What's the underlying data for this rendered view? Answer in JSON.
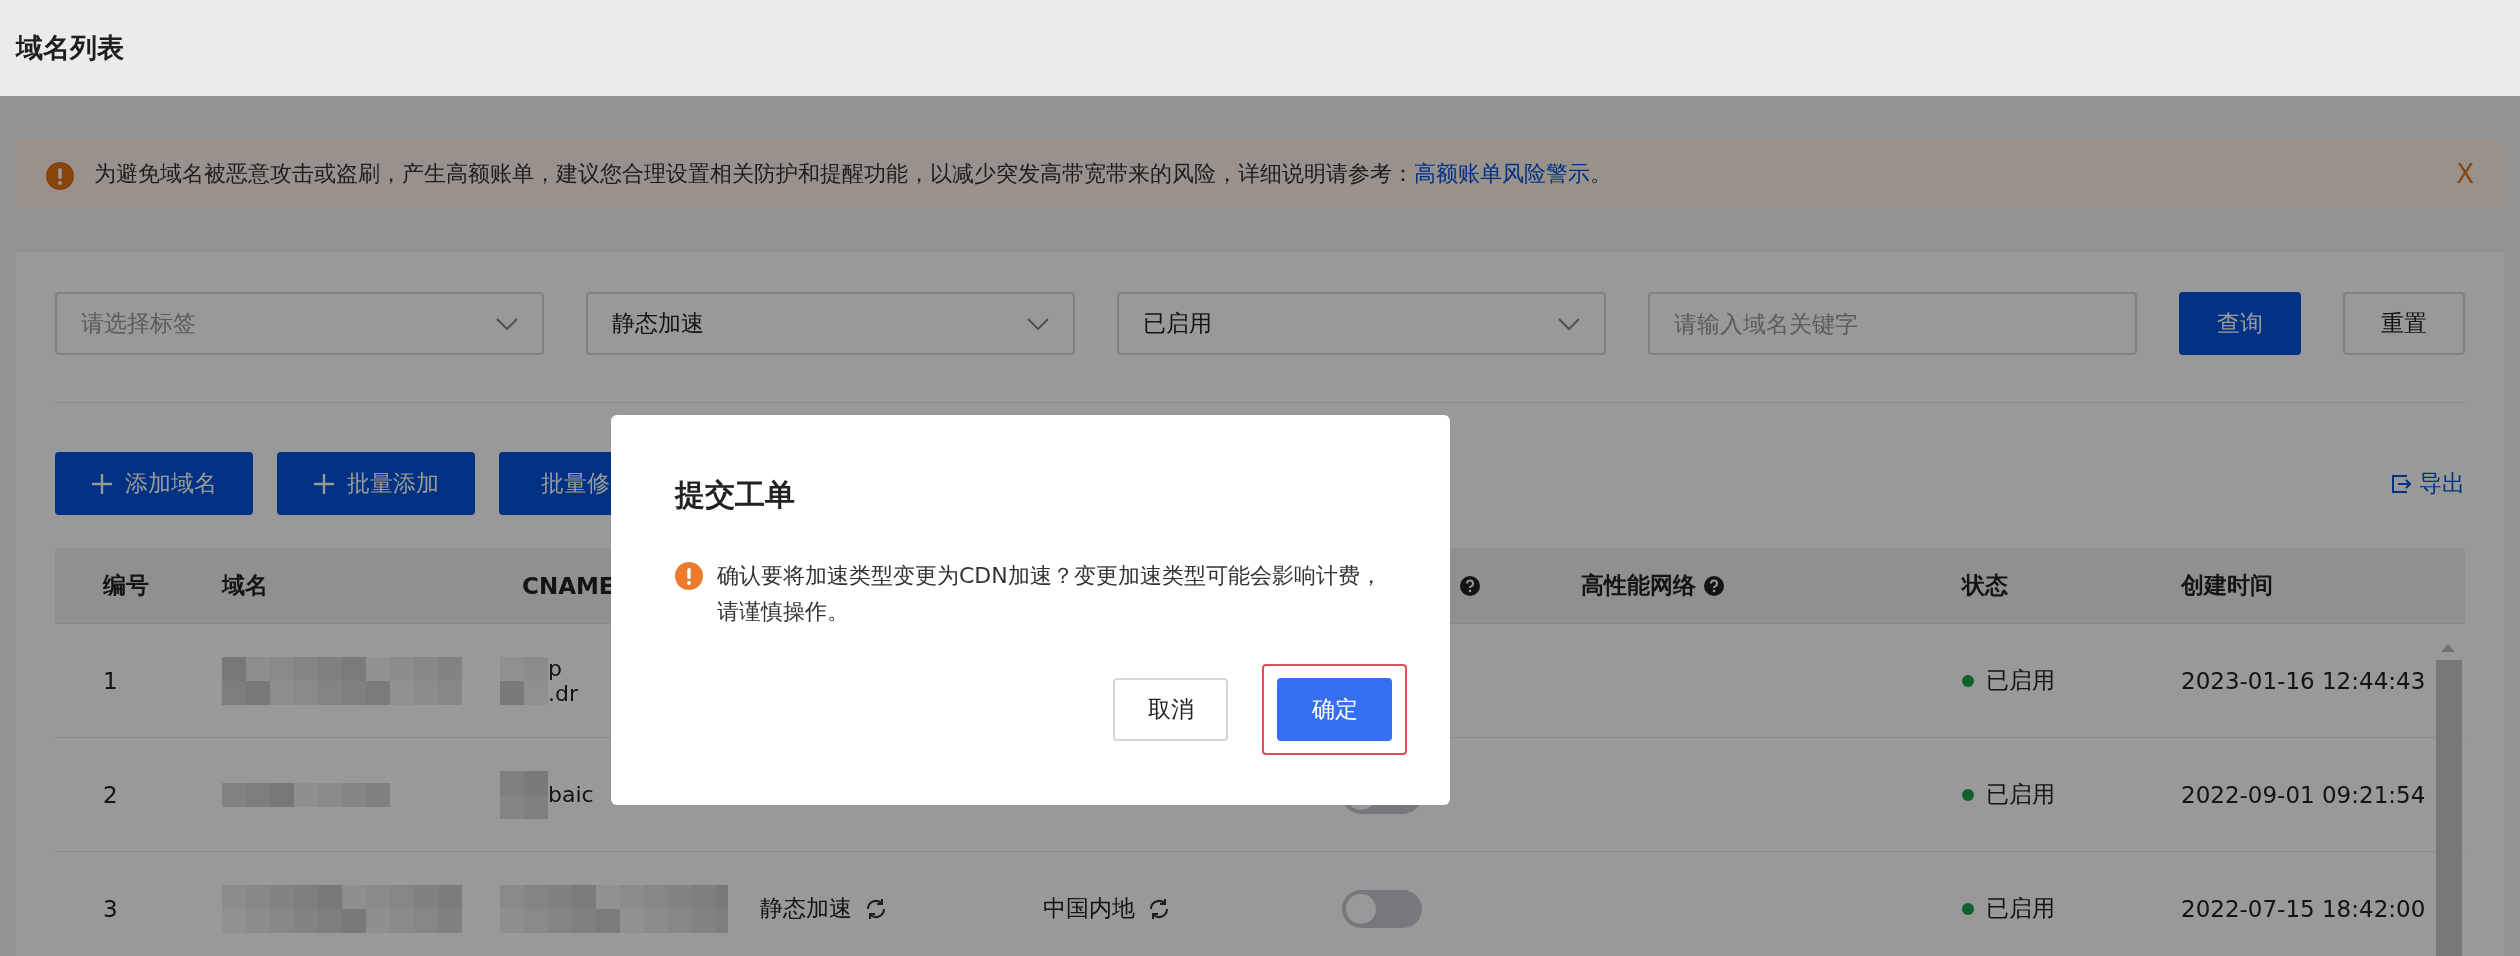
{
  "page_title": "域名列表",
  "alert": {
    "message": "为避免域名被恶意攻击或盗刷，产生高额账单，建议您合理设置相关防护和提醒功能，以减少突发高带宽带来的风险，详细说明请参考：",
    "link": "高额账单风险警示",
    "suffix": "。",
    "close": "X"
  },
  "filters": [
    {
      "kind": "select",
      "placeholder": "请选择标签"
    },
    {
      "kind": "select",
      "value": "静态加速"
    },
    {
      "kind": "select",
      "value": "已启用"
    },
    {
      "kind": "input",
      "placeholder": "请输入域名关键字"
    }
  ],
  "search_button": "查询",
  "reset_button": "重置",
  "actions": [
    {
      "label": "添加域名",
      "plus": true
    },
    {
      "label": "批量添加",
      "plus": true
    },
    {
      "label": "批量修",
      "plus": false
    }
  ],
  "export": "导出",
  "table": {
    "columns": [
      {
        "label": "编号"
      },
      {
        "label": "域名"
      },
      {
        "label": "CNAME"
      },
      {},
      {},
      {
        "help": true
      },
      {
        "label": "高性能网络",
        "help": true
      },
      {
        "label": "状态"
      },
      {
        "label": "创建时间"
      }
    ],
    "rows": [
      {
        "number": "1",
        "cname_fragments": [
          "p",
          ".dr"
        ],
        "status": "已启用",
        "created": "2023-01-16 12:44:43"
      },
      {
        "number": "2",
        "cname_fragments": [
          "baic"
        ],
        "toggle": {
          "on": false
        },
        "status": "已启用",
        "created": "2022-09-01 09:21:54"
      },
      {
        "number": "3",
        "cname_fragments": [],
        "acceleration": "静态加速",
        "region": "中国内地",
        "toggle": {
          "on": false
        },
        "status": "已启用",
        "created": "2022-07-15 18:42:00"
      }
    ]
  },
  "dialog": {
    "title": "提交工单",
    "message": "确认要将加速类型变更为CDN加速？变更加速类型可能会影响计费，请谨慎操作。",
    "cancel": "取消",
    "confirm": "确定",
    "confirm_highlighted": true
  }
}
